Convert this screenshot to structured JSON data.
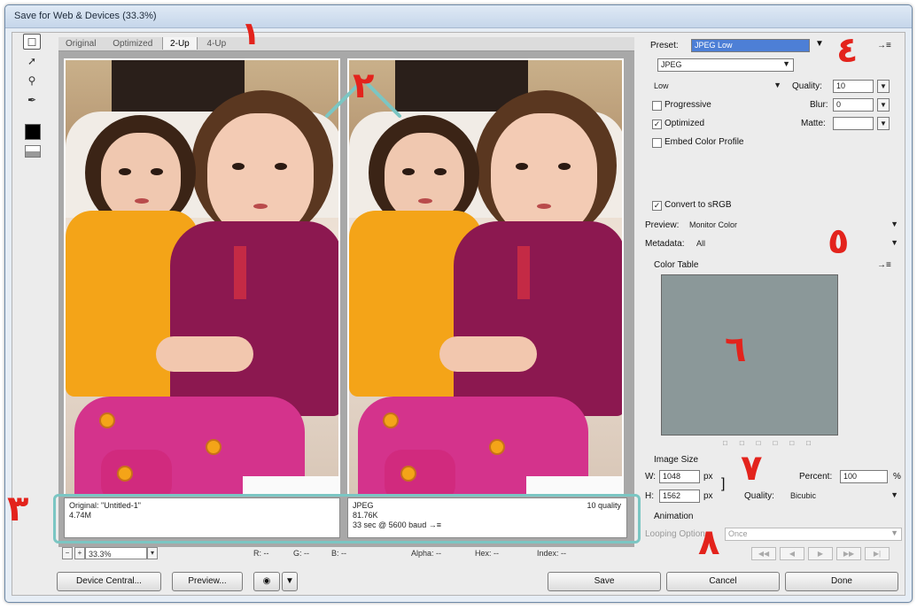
{
  "window": {
    "title": "Save for Web & Devices (33.3%)"
  },
  "tabs": [
    "Original",
    "Optimized",
    "2-Up",
    "4-Up"
  ],
  "active_tab": 2,
  "left_info": {
    "name": "Original: \"Untitled-1\"",
    "size": "4.74M"
  },
  "right_info": {
    "format": "JPEG",
    "size": "81.76K",
    "time": "33 sec @ 5600 baud",
    "quality": "10 quality",
    "menu": "→≡"
  },
  "status": {
    "zoom": "33.3%",
    "r": "R: --",
    "g": "G: --",
    "b": "B: --",
    "alpha": "Alpha: --",
    "hex": "Hex: --",
    "index": "Index: --"
  },
  "settings": {
    "preset_label": "Preset:",
    "preset_value": "JPEG Low",
    "format": "JPEG",
    "quality_level": "Low",
    "quality_label": "Quality:",
    "quality_value": "10",
    "progressive": "Progressive",
    "blur_label": "Blur:",
    "blur_value": "0",
    "optimized": "Optimized",
    "matte_label": "Matte:",
    "embed": "Embed Color Profile",
    "convert": "Convert to sRGB",
    "preview_label": "Preview:",
    "preview_value": "Monitor Color",
    "metadata_label": "Metadata:",
    "metadata_value": "All",
    "color_table": "Color Table",
    "image_size": "Image Size",
    "w_label": "W:",
    "w_value": "1048",
    "h_label": "H:",
    "h_value": "1562",
    "unit": "px",
    "percent_label": "Percent:",
    "percent_value": "100",
    "percent_unit": "%",
    "resample_label": "Quality:",
    "resample_value": "Bicubic",
    "animation": "Animation",
    "looping_label": "Looping Options:",
    "looping_value": "Once",
    "menu_icon": "→≡"
  },
  "buttons": {
    "device_central": "Device Central...",
    "preview": "Preview...",
    "save": "Save",
    "cancel": "Cancel",
    "done": "Done"
  },
  "annotations": [
    "١",
    "٢",
    "٣",
    "٤",
    "٥",
    "٦",
    "٧",
    "٨"
  ],
  "colors": {
    "annotation": "#e3231c",
    "highlight": "#7bc6c3",
    "preset_selection": "#4d7fd6"
  }
}
